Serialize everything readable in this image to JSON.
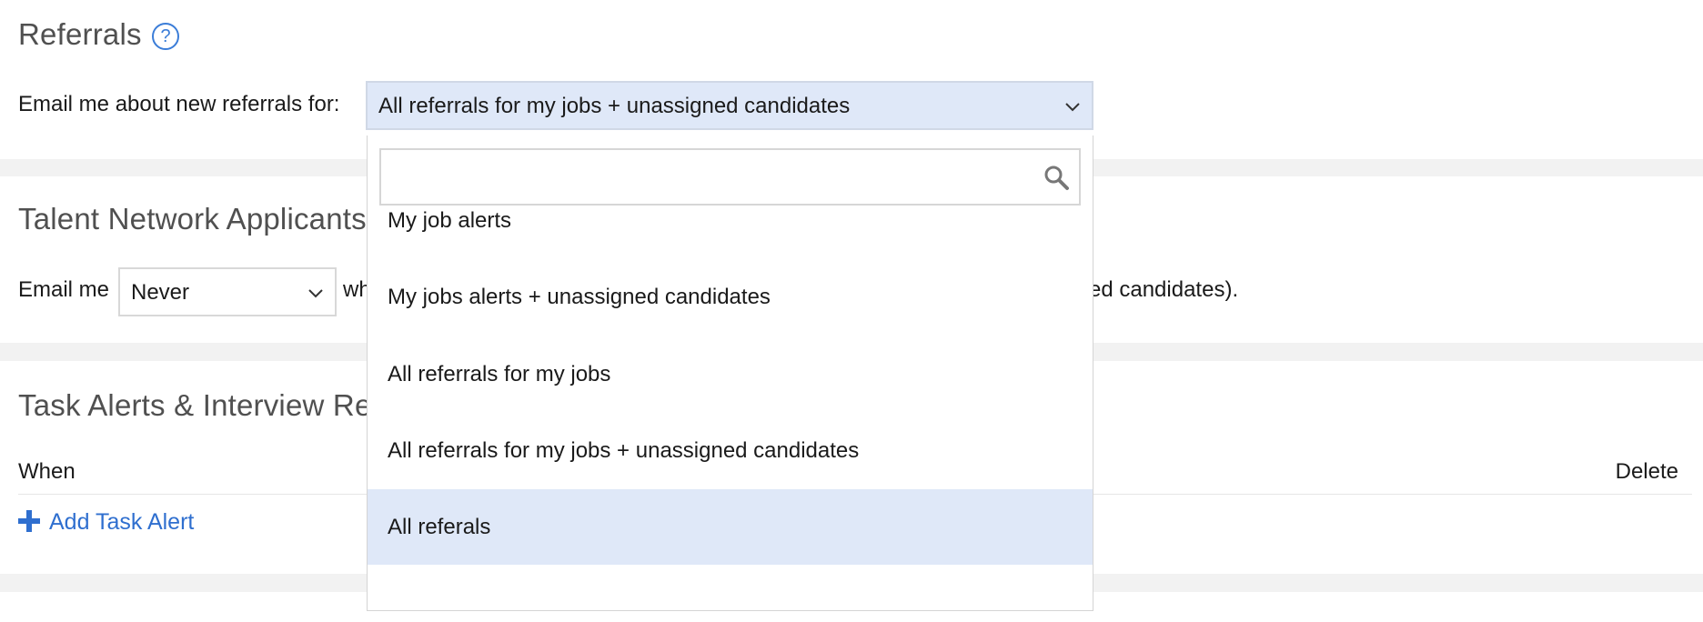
{
  "referrals": {
    "title": "Referrals",
    "help_glyph": "?",
    "email_label": "Email me about new referrals for:",
    "selected_value": "All referrals for my jobs + unassigned candidates",
    "dropdown": {
      "search_value": "",
      "options": [
        {
          "label": "My job alerts"
        },
        {
          "label": "My jobs alerts + unassigned candidates"
        },
        {
          "label": "All referrals for my jobs"
        },
        {
          "label": "All referrals for my jobs + unassigned candidates"
        },
        {
          "label": "All referals",
          "highlighted": true
        }
      ]
    }
  },
  "talent_network": {
    "title": "Talent Network Applicants",
    "email_prefix": "Email me",
    "frequency_value": "Never",
    "text_fragment_left": "wh",
    "text_fragment_right": "ed candidates)."
  },
  "task_alerts": {
    "title_visible": "Task Alerts & Interview Re",
    "col_when": "When",
    "col_delete": "Delete",
    "add_label": "Add Task Alert"
  },
  "colors": {
    "accent": "#2f6fcf",
    "selected_bg": "#dfe8f8",
    "divider": "#f2f2f2"
  },
  "icons": {
    "help": "question-circle-icon",
    "chevron": "chevron-down-icon",
    "search": "search-icon",
    "add": "plus-icon"
  }
}
